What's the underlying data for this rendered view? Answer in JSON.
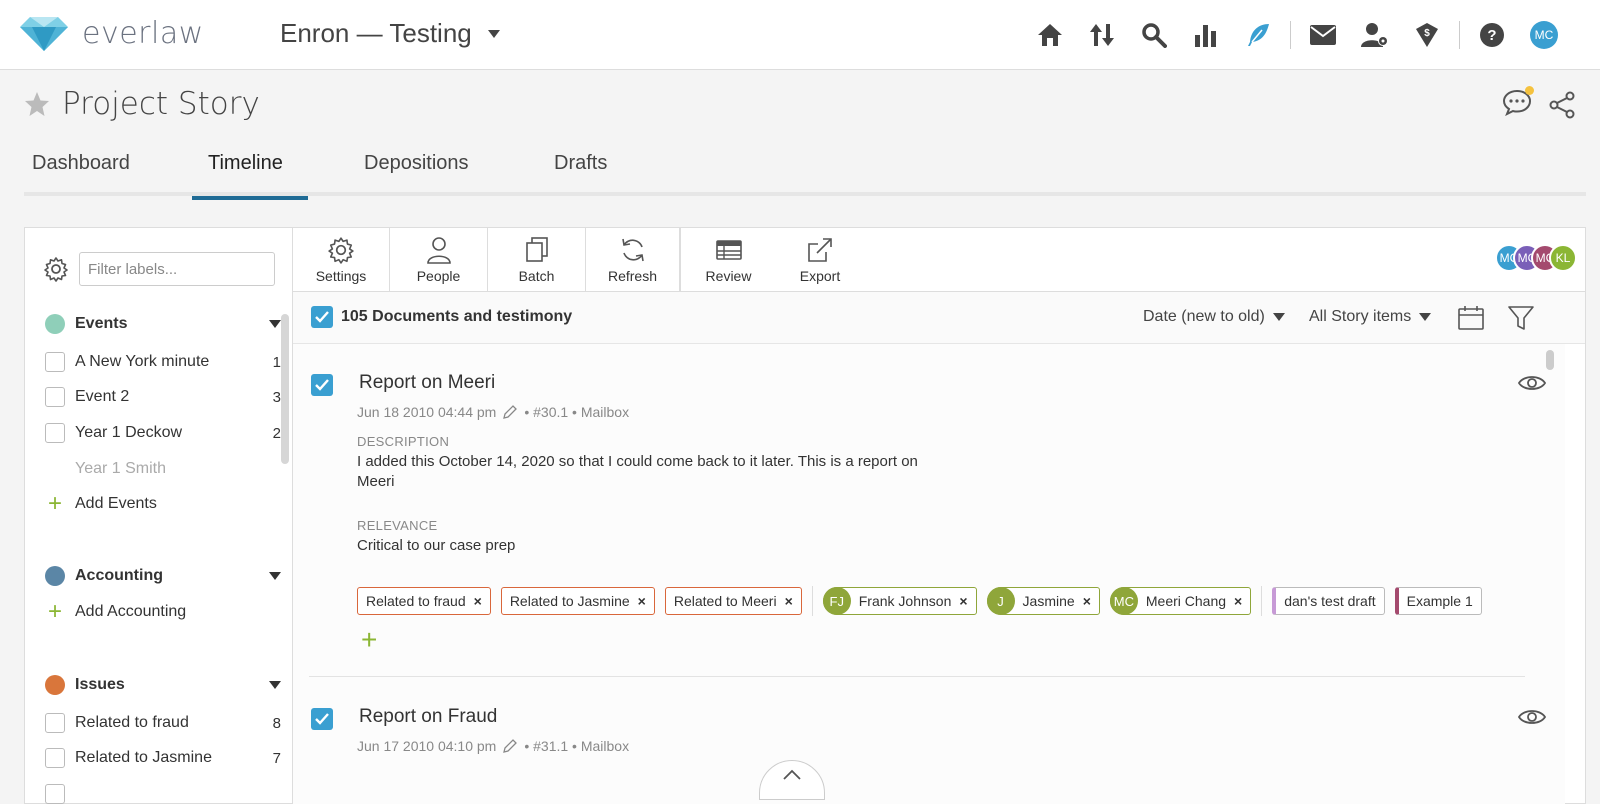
{
  "app": {
    "logo_text": "everlaw",
    "project": "Enron — Testing",
    "user_initials": "MC"
  },
  "page": {
    "title": "Project Story"
  },
  "tabs": [
    {
      "label": "Dashboard",
      "active": false
    },
    {
      "label": "Timeline",
      "active": true
    },
    {
      "label": "Depositions",
      "active": false
    },
    {
      "label": "Drafts",
      "active": false
    }
  ],
  "sidebar": {
    "filter_placeholder": "Filter labels...",
    "sections": {
      "events": {
        "name": "Events",
        "color": "#8fcfb9",
        "items": [
          {
            "label": "A New York minute",
            "count": "1"
          },
          {
            "label": "Event 2",
            "count": "3"
          },
          {
            "label": "Year 1 Deckow",
            "count": "2"
          },
          {
            "label": "Year 1 Smith",
            "count": ""
          }
        ],
        "add_label": "Add Events"
      },
      "accounting": {
        "name": "Accounting",
        "color": "#5b86a6",
        "add_label": "Add Accounting"
      },
      "issues": {
        "name": "Issues",
        "color": "#d9763b",
        "items": [
          {
            "label": "Related to fraud",
            "count": "8"
          },
          {
            "label": "Related to Jasmine",
            "count": "7"
          }
        ]
      }
    }
  },
  "toolbar": {
    "settings": "Settings",
    "people": "People",
    "batch": "Batch",
    "refresh": "Refresh",
    "review": "Review",
    "export": "Export",
    "collaborators": [
      {
        "initials": "MC",
        "color": "#3a9fd1"
      },
      {
        "initials": "MC",
        "color": "#7a5fb8"
      },
      {
        "initials": "MC",
        "color": "#a44a6e"
      },
      {
        "initials": "KL",
        "color": "#8bb634"
      }
    ]
  },
  "list": {
    "count_label": "105 Documents and testimony",
    "sort_label": "Date (new to old)",
    "scope_label": "All Story items"
  },
  "stories": [
    {
      "title": "Report on Meeri",
      "date": "Jun 18 2010 04:44 pm",
      "meta_rest": "• #30.1 • Mailbox",
      "description_label": "DESCRIPTION",
      "description": "I added this October 14, 2020 so that I could come back to it later. This is a report on Meeri",
      "relevance_label": "RELEVANCE",
      "relevance": "Critical to our case prep",
      "issue_chips": [
        "Related to fraud",
        "Related to Jasmine",
        "Related to Meeri"
      ],
      "people_chips": [
        {
          "initials": "FJ",
          "name": "Frank Johnson"
        },
        {
          "initials": "J",
          "name": "Jasmine"
        },
        {
          "initials": "MC",
          "name": "Meeri Chang"
        }
      ],
      "draft_chips": [
        "dan's test draft",
        "Example 1"
      ]
    },
    {
      "title": "Report on Fraud",
      "date": "Jun 17 2010 04:10 pm",
      "meta_rest": "• #31.1 • Mailbox"
    }
  ]
}
